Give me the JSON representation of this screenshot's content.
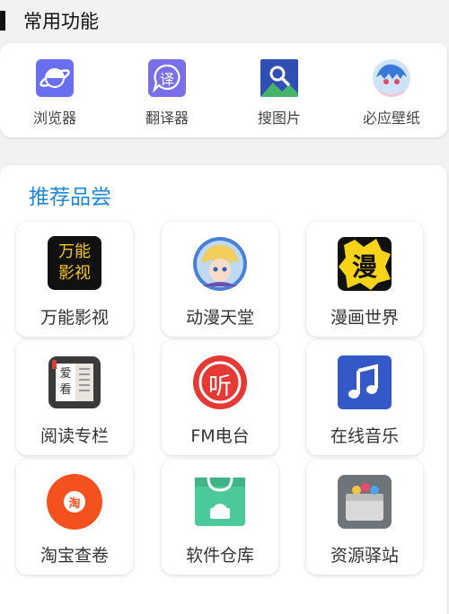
{
  "header": {
    "title": "常用功能"
  },
  "tools": [
    {
      "label": "浏览器",
      "icon": "browser-planet-icon"
    },
    {
      "label": "翻译器",
      "icon": "translate-icon",
      "glyph": "译"
    },
    {
      "label": "搜图片",
      "icon": "image-search-icon"
    },
    {
      "label": "必应壁纸",
      "icon": "anime-wallpaper-icon"
    }
  ],
  "recommend": {
    "title": "推荐品尝",
    "apps": [
      {
        "label": "万能影视",
        "icon": "wanneng-video-icon",
        "icon_text_1": "万能",
        "icon_text_2": "影视"
      },
      {
        "label": "动漫天堂",
        "icon": "anime-avatar-icon"
      },
      {
        "label": "漫画世界",
        "icon": "manga-icon",
        "icon_text": "漫"
      },
      {
        "label": "阅读专栏",
        "icon": "book-reader-icon",
        "icon_text_1": "爱",
        "icon_text_2": "看"
      },
      {
        "label": "FM电台",
        "icon": "fm-radio-icon",
        "icon_text": "听"
      },
      {
        "label": "在线音乐",
        "icon": "music-note-icon"
      },
      {
        "label": "淘宝查卷",
        "icon": "taobao-icon",
        "icon_text": "淘"
      },
      {
        "label": "软件仓库",
        "icon": "app-store-bag-icon"
      },
      {
        "label": "资源驿站",
        "icon": "resource-box-icon"
      }
    ]
  },
  "colors": {
    "accent_blue": "#1e88d8",
    "browser_purple": "#6a6ef0",
    "translate_purple": "#7a6fe8",
    "image_search_blue": "#2f4fb5",
    "fm_red": "#e53935",
    "music_blue": "#3558c8",
    "taobao_orange": "#f5511e",
    "store_green": "#4cc99a"
  }
}
